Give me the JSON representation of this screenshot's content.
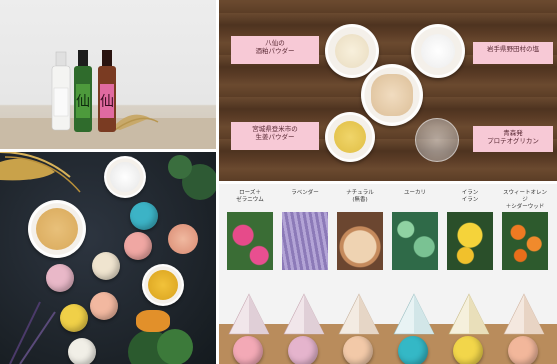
{
  "ingredients": {
    "label_yuzu_powder": "八仙の\n酒粕パウダー",
    "label_salt": "岩手県野田村の塩",
    "label_soybean": "宮城県登米市の\n生姜パウダー",
    "label_glycan": "青森発\nプロテオグリカン"
  },
  "scents": [
    {
      "name": "ローズ＋\nゼラニウム"
    },
    {
      "name": "ラベンダー"
    },
    {
      "name": "ナチュラル\n(無香)"
    },
    {
      "name": "ユーカリ"
    },
    {
      "name": "イラン\nイラン"
    },
    {
      "name": "スウィートオレンジ\n＋シダーウッド"
    }
  ],
  "bottles": {
    "label_middle": "仙",
    "label_right": "仙"
  },
  "colors": {
    "pink_label": "#f7c9d6"
  }
}
